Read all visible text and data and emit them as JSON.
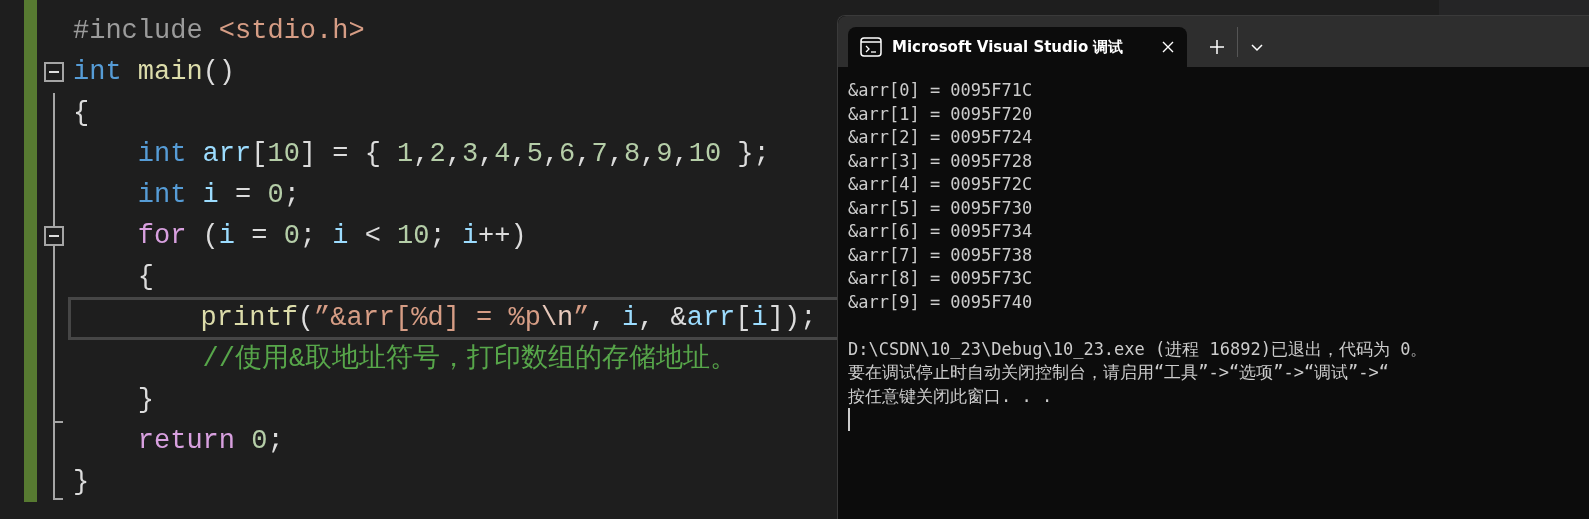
{
  "editor": {
    "lines": [
      {
        "fold": false,
        "current": false,
        "tokens": [
          {
            "kind": "preproc",
            "text": "#include "
          },
          {
            "kind": "string",
            "text": "<stdio.h>"
          }
        ]
      },
      {
        "fold": true,
        "current": false,
        "tokens": [
          {
            "kind": "keyword",
            "text": "int"
          },
          {
            "kind": "function",
            "text": " main"
          },
          {
            "kind": "plain",
            "text": "()"
          }
        ]
      },
      {
        "fold": false,
        "current": false,
        "tokens": [
          {
            "kind": "plain",
            "text": "{"
          }
        ]
      },
      {
        "fold": false,
        "current": false,
        "tokens": [
          {
            "kind": "keyword",
            "text": "    int"
          },
          {
            "kind": "variable",
            "text": " arr"
          },
          {
            "kind": "plain",
            "text": "["
          },
          {
            "kind": "number",
            "text": "10"
          },
          {
            "kind": "plain",
            "text": "] = { "
          },
          {
            "kind": "number",
            "text": "1"
          },
          {
            "kind": "plain",
            "text": ","
          },
          {
            "kind": "number",
            "text": "2"
          },
          {
            "kind": "plain",
            "text": ","
          },
          {
            "kind": "number",
            "text": "3"
          },
          {
            "kind": "plain",
            "text": ","
          },
          {
            "kind": "number",
            "text": "4"
          },
          {
            "kind": "plain",
            "text": ","
          },
          {
            "kind": "number",
            "text": "5"
          },
          {
            "kind": "plain",
            "text": ","
          },
          {
            "kind": "number",
            "text": "6"
          },
          {
            "kind": "plain",
            "text": ","
          },
          {
            "kind": "number",
            "text": "7"
          },
          {
            "kind": "plain",
            "text": ","
          },
          {
            "kind": "number",
            "text": "8"
          },
          {
            "kind": "plain",
            "text": ","
          },
          {
            "kind": "number",
            "text": "9"
          },
          {
            "kind": "plain",
            "text": ","
          },
          {
            "kind": "number",
            "text": "10"
          },
          {
            "kind": "plain",
            "text": " };"
          }
        ]
      },
      {
        "fold": false,
        "current": false,
        "tokens": [
          {
            "kind": "keyword",
            "text": "    int"
          },
          {
            "kind": "variable",
            "text": " i"
          },
          {
            "kind": "plain",
            "text": " = "
          },
          {
            "kind": "number",
            "text": "0"
          },
          {
            "kind": "plain",
            "text": ";"
          }
        ]
      },
      {
        "fold": true,
        "current": false,
        "tokens": [
          {
            "kind": "control",
            "text": "    for"
          },
          {
            "kind": "plain",
            "text": " ("
          },
          {
            "kind": "variable",
            "text": "i"
          },
          {
            "kind": "plain",
            "text": " = "
          },
          {
            "kind": "number",
            "text": "0"
          },
          {
            "kind": "plain",
            "text": "; "
          },
          {
            "kind": "variable",
            "text": "i"
          },
          {
            "kind": "plain",
            "text": " < "
          },
          {
            "kind": "number",
            "text": "10"
          },
          {
            "kind": "plain",
            "text": "; "
          },
          {
            "kind": "variable",
            "text": "i"
          },
          {
            "kind": "plain",
            "text": "++)"
          }
        ]
      },
      {
        "fold": false,
        "current": false,
        "tokens": [
          {
            "kind": "plain",
            "text": "    {"
          }
        ]
      },
      {
        "fold": false,
        "current": true,
        "tokens": [
          {
            "kind": "function",
            "text": "        printf"
          },
          {
            "kind": "plain",
            "text": "("
          },
          {
            "kind": "string",
            "text": "”&arr[%d] = %p"
          },
          {
            "kind": "escape",
            "text": "\\n"
          },
          {
            "kind": "string",
            "text": "”"
          },
          {
            "kind": "plain",
            "text": ", "
          },
          {
            "kind": "variable",
            "text": "i"
          },
          {
            "kind": "plain",
            "text": ", &"
          },
          {
            "kind": "variable",
            "text": "arr"
          },
          {
            "kind": "plain",
            "text": "["
          },
          {
            "kind": "variable",
            "text": "i"
          },
          {
            "kind": "plain",
            "text": "]);"
          }
        ]
      },
      {
        "fold": false,
        "current": false,
        "tokens": [
          {
            "kind": "comment",
            "text": "        //使用&取地址符号，打印数组的存储地址。"
          }
        ]
      },
      {
        "fold": false,
        "current": false,
        "tokens": [
          {
            "kind": "plain",
            "text": "    }"
          }
        ]
      },
      {
        "fold": false,
        "current": false,
        "tokens": [
          {
            "kind": "control",
            "text": "    return"
          },
          {
            "kind": "number",
            "text": " 0"
          },
          {
            "kind": "plain",
            "text": ";"
          }
        ]
      },
      {
        "fold": false,
        "current": false,
        "tokens": [
          {
            "kind": "plain",
            "text": "}"
          }
        ]
      }
    ]
  },
  "console": {
    "tab": {
      "title": "Microsoft Visual Studio 调试",
      "selected": true
    },
    "output": [
      "&arr[0] = 0095F71C",
      "&arr[1] = 0095F720",
      "&arr[2] = 0095F724",
      "&arr[3] = 0095F728",
      "&arr[4] = 0095F72C",
      "&arr[5] = 0095F730",
      "&arr[6] = 0095F734",
      "&arr[7] = 0095F738",
      "&arr[8] = 0095F73C",
      "&arr[9] = 0095F740"
    ],
    "messages": [
      "D:\\CSDN\\10_23\\Debug\\10_23.exe (进程 16892)已退出，代码为 0。",
      "要在调试停止时自动关闭控制台，请启用“工具”->“选项”->“调试”->“",
      "按任意键关闭此窗口. . ."
    ]
  }
}
